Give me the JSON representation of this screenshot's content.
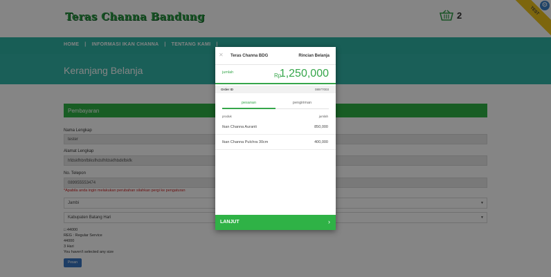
{
  "site": {
    "logo": "Teras Channa Bandung",
    "cart_count": "2",
    "ribbon": "TEST"
  },
  "nav": {
    "items": [
      "HOME",
      "|",
      "INFORMASI IKAN CHANNA",
      "|",
      "TENTANG KAMI",
      "|"
    ]
  },
  "hero": {
    "title": "Keranjang Belanja"
  },
  "payment": {
    "header": "Pembayaran",
    "name_label": "Nama Lengkap",
    "name_value": "tester",
    "address_label": "Alamat Lengkap",
    "address_value": "hfdskfhbnfblksfhdsfhfdskfhbdkfbkfk",
    "phone_label": "No. Telepon",
    "phone_value": "089955553474",
    "warning": "*Apabila anda ingin melakukan perubahan silahkan pergi ke pengaturan",
    "province": "Jambi",
    "city": "Kabupaten Batang Hari",
    "shipping": [
      "□ 44000",
      "REG : Regular Service",
      "44000",
      "3 Hari",
      "You haven't selected any size"
    ],
    "choose_button": "Pesan"
  },
  "modal": {
    "merchant": "Teras Channa BDG",
    "details_title": "Rincian Belanja",
    "amount_label": "jumlah",
    "currency": "Rp",
    "amount": "1,250,000",
    "order_id_label": "Order ID",
    "order_id": "08977003",
    "tabs": [
      "pesanan",
      "pengiriman"
    ],
    "list_header": {
      "product": "produk",
      "amount": "jumlah"
    },
    "items": [
      {
        "name": "Ikan Channa Auranti",
        "price": "850,000"
      },
      {
        "name": "Ikan Channa Pulchra 30cm",
        "price": "400,000"
      }
    ],
    "continue_label": "LANJUT",
    "continue_arrow": "›"
  },
  "colors": {
    "accent_green": "#35a64a",
    "teal_nav": "#2fb4a6"
  }
}
